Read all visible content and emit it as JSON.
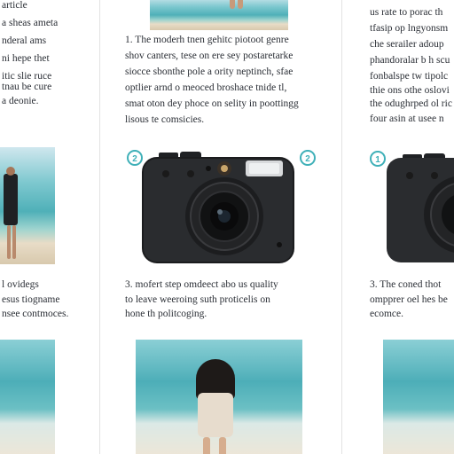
{
  "left": {
    "top_lines": [
      "article",
      "a sheas ameta",
      "nderal ams",
      "ni hepe thet",
      "itic slie ruce",
      "tnau be cure",
      "a deonie."
    ],
    "mid_lines": [
      "l ovidegs",
      "esus tiogname",
      "nsee contmoces."
    ]
  },
  "middle": {
    "para1": [
      "1.  The moderh tnen gehitc piotoot genre",
      "shov canters, tese on ere sey postaretarke",
      "siocce sbonthe pole a ority neptinch, sfae",
      "optlier arnd o meoced broshace tnide tl,",
      "smat oton dey phoce on selity in poottingg",
      "lisous te comsicies."
    ],
    "para2": [
      "3.  mofert step omdeect abo us quality",
      "to leave weeroing suth proticelis on",
      "hone th politcoging."
    ],
    "badge_left": "2",
    "badge_right": "2"
  },
  "right": {
    "top_lines": [
      "us rate to porac th",
      "tfasip op lngyonsm",
      "che serailer adoup",
      "phandoralar b h scu",
      "fonbalspe tw tipolc",
      "thie ons othe oslovi",
      "the odughrped ol ric",
      "four asin at usee n"
    ],
    "para2": [
      "3.  The coned thot",
      "ompprer oel hes be",
      "ecomce."
    ],
    "badge": "1"
  },
  "colors": {
    "accent": "#3fb0b8",
    "text": "#2b2f36",
    "camera_body": "#2a2c2f"
  }
}
